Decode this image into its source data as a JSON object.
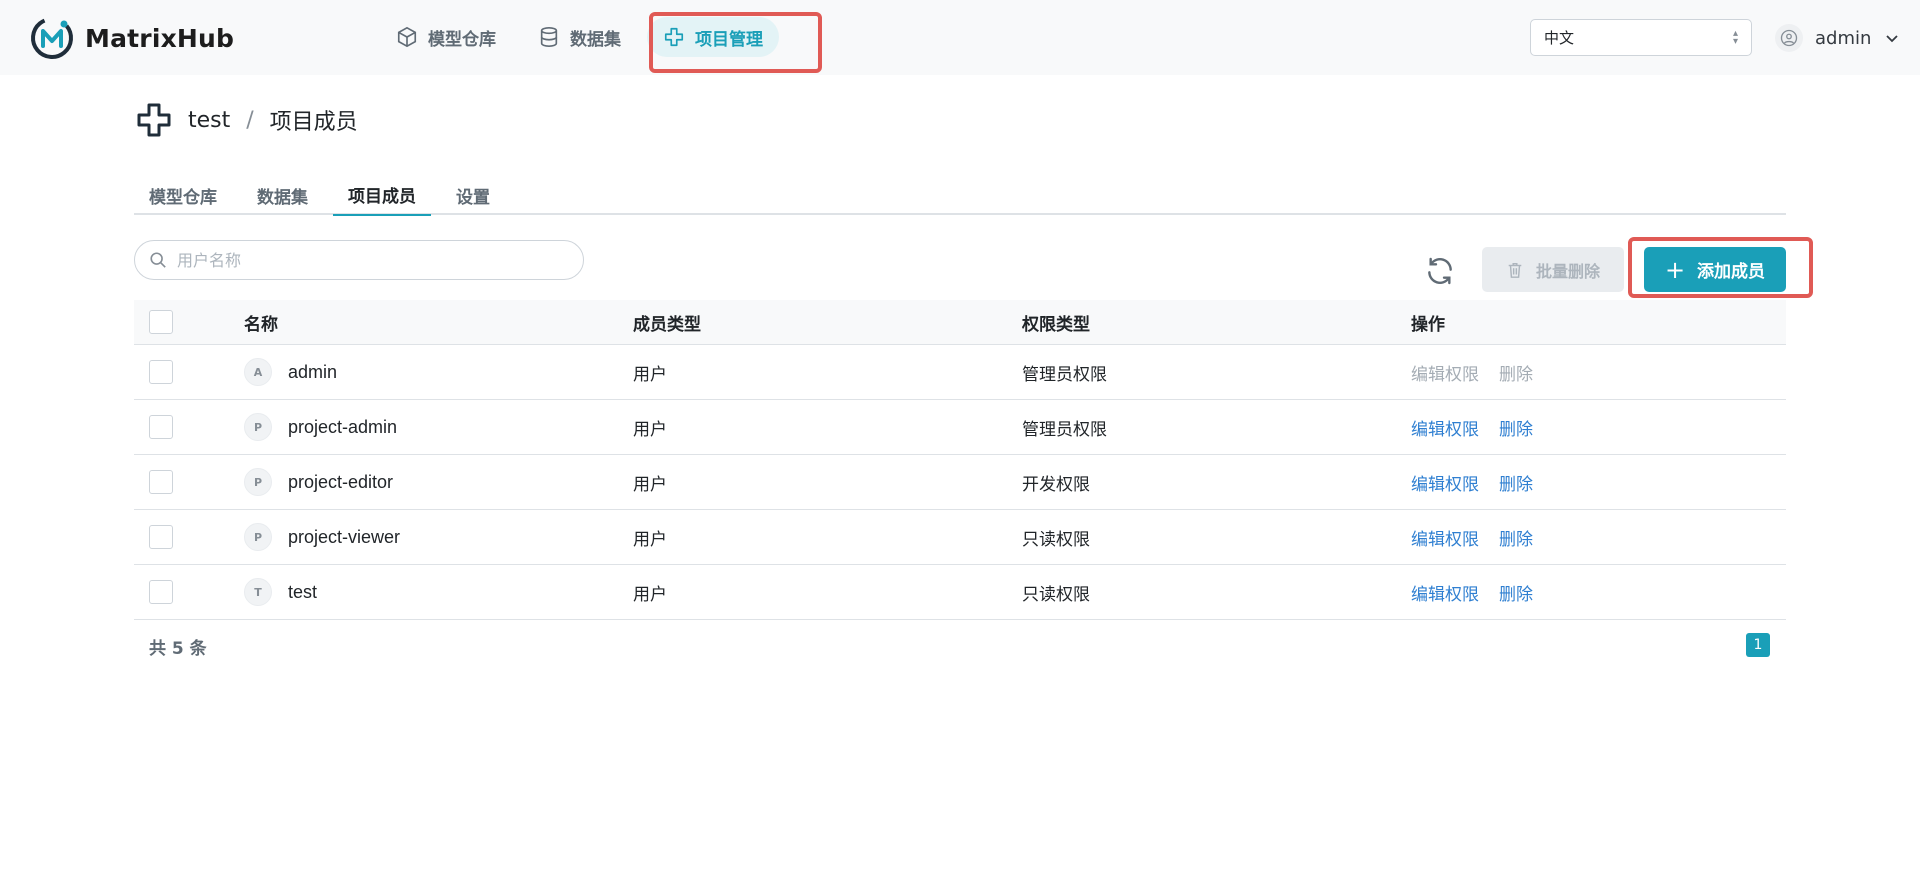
{
  "header": {
    "app_name": "MatrixHub",
    "nav": [
      {
        "label": "模型仓库",
        "icon": "cube-icon"
      },
      {
        "label": "数据集",
        "icon": "database-icon"
      },
      {
        "label": "项目管理",
        "icon": "project-icon",
        "active": true
      }
    ],
    "language": "中文",
    "username": "admin"
  },
  "breadcrumb": {
    "project": "test",
    "separator": "/",
    "page": "项目成员"
  },
  "tabs": [
    {
      "label": "模型仓库"
    },
    {
      "label": "数据集"
    },
    {
      "label": "项目成员",
      "active": true
    },
    {
      "label": "设置"
    }
  ],
  "toolbar": {
    "search_placeholder": "用户名称",
    "batch_delete_label": "批量删除",
    "add_member_label": "添加成员"
  },
  "table": {
    "headers": {
      "name": "名称",
      "member_type": "成员类型",
      "permission": "权限类型",
      "operations": "操作"
    },
    "rows": [
      {
        "initial": "A",
        "name": "admin",
        "member_type": "用户",
        "permission": "管理员权限",
        "edit": "编辑权限",
        "delete": "删除",
        "disabled": true
      },
      {
        "initial": "P",
        "name": "project-admin",
        "member_type": "用户",
        "permission": "管理员权限",
        "edit": "编辑权限",
        "delete": "删除",
        "disabled": false
      },
      {
        "initial": "P",
        "name": "project-editor",
        "member_type": "用户",
        "permission": "开发权限",
        "edit": "编辑权限",
        "delete": "删除",
        "disabled": false
      },
      {
        "initial": "P",
        "name": "project-viewer",
        "member_type": "用户",
        "permission": "只读权限",
        "edit": "编辑权限",
        "delete": "删除",
        "disabled": false
      },
      {
        "initial": "T",
        "name": "test",
        "member_type": "用户",
        "permission": "只读权限",
        "edit": "编辑权限",
        "delete": "删除",
        "disabled": false
      }
    ]
  },
  "footer": {
    "total": "共 5 条",
    "current_page": "1"
  },
  "colors": {
    "accent": "#1a9fb8",
    "link": "#2f7fd1",
    "highlight": "#e05a55"
  }
}
